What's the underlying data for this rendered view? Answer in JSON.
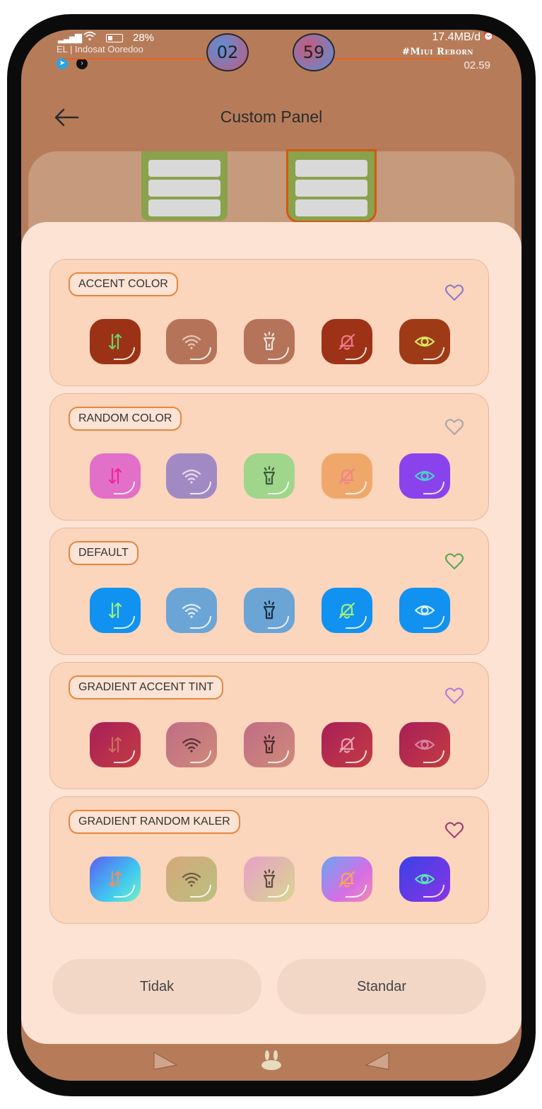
{
  "status_bar": {
    "carrier": "EL | Indosat Ooredoo",
    "battery": "28%",
    "clock_hours": "02",
    "clock_minutes": "59",
    "net_speed": "17.4MB/d",
    "brand": "#Miui Reborn",
    "time": "02.59",
    "icons": [
      "signal-icon",
      "wifi-icon",
      "battery-icon",
      "telegram-icon",
      "terminal-icon",
      "alarm-off-icon"
    ]
  },
  "header": {
    "title": "Custom Panel",
    "back_icon": "arrow-left-icon"
  },
  "groups": [
    {
      "label": "ACCENT COLOR",
      "heart_color": "#8a79c9",
      "tiles": [
        {
          "icon": "data-arrows-icon",
          "bg": "#9b3215",
          "fg": "#6cd36a"
        },
        {
          "icon": "wifi-icon",
          "bg": "#b5735a",
          "fg": "#e6c7b8"
        },
        {
          "icon": "flashlight-icon",
          "bg": "#b5735a",
          "fg": "#efe2da"
        },
        {
          "icon": "bell-off-icon",
          "bg": "#9e3216",
          "fg": "#f1788c"
        },
        {
          "icon": "eye-icon",
          "bg": "#9e3b16",
          "fg": "#d6ea67"
        }
      ]
    },
    {
      "label": "RANDOM COLOR",
      "heart_color": "#a7a7a7",
      "tiles": [
        {
          "icon": "data-arrows-icon",
          "bg": "#e26fc8",
          "fg": "#f3239c"
        },
        {
          "icon": "wifi-icon",
          "bg": "#a18ac4",
          "fg": "#e8dcf2"
        },
        {
          "icon": "flashlight-icon",
          "bg": "#9fd68b",
          "fg": "#3e5a37"
        },
        {
          "icon": "bell-off-icon",
          "bg": "#f0a86a",
          "fg": "#f0848a"
        },
        {
          "icon": "eye-icon",
          "bg": "#8a43ec",
          "fg": "#4bd2c6"
        }
      ]
    },
    {
      "label": "DEFAULT",
      "heart_color": "#55a84d",
      "tiles": [
        {
          "icon": "data-arrows-icon",
          "bg": "#1192f0",
          "fg": "#9ff17b"
        },
        {
          "icon": "wifi-icon",
          "bg": "#6aa5d6",
          "fg": "#e7f0f7"
        },
        {
          "icon": "flashlight-icon",
          "bg": "#6aa5d6",
          "fg": "#1b2d3d"
        },
        {
          "icon": "bell-off-icon",
          "bg": "#1192f0",
          "fg": "#9ff17b"
        },
        {
          "icon": "eye-icon",
          "bg": "#1192f0",
          "fg": "#d9f0ff"
        }
      ]
    },
    {
      "label": "GRADIENT ACCENT TINT",
      "heart_color": "#b17ad9",
      "tiles": [
        {
          "icon": "data-arrows-icon",
          "bg": "#b9235a",
          "fg": "#c9705e",
          "gradient": "linear-gradient(135deg,#a81f5a,#c43c40)"
        },
        {
          "icon": "wifi-icon",
          "bg": "#c67580",
          "fg": "#5a3136",
          "gradient": "linear-gradient(135deg,#c06d86,#cf8a78)"
        },
        {
          "icon": "flashlight-icon",
          "bg": "#c67580",
          "fg": "#4e2a2a",
          "gradient": "linear-gradient(135deg,#c06d86,#cf8a78)"
        },
        {
          "icon": "bell-off-icon",
          "bg": "#b9235a",
          "fg": "#e7a4b4",
          "gradient": "linear-gradient(135deg,#a81f5a,#c43c40)"
        },
        {
          "icon": "eye-icon",
          "bg": "#b9235a",
          "fg": "#d983a2",
          "gradient": "linear-gradient(135deg,#a81f5a,#c43c40)"
        }
      ]
    },
    {
      "label": "GRADIENT RANDOM KALER",
      "heart_color": "#a13a6a",
      "tiles": [
        {
          "icon": "data-arrows-icon",
          "bg": "#4e7ff0",
          "fg": "#ff8a58",
          "gradient": "linear-gradient(135deg,#5b5ff2,#40c8f0 60%,#74f0c4)"
        },
        {
          "icon": "wifi-icon",
          "bg": "#c9ae7c",
          "fg": "#6a5a40",
          "gradient": "linear-gradient(135deg,#d5a87a,#b9c07f)"
        },
        {
          "icon": "flashlight-icon",
          "bg": "#e7aec0",
          "fg": "#5b4a3f",
          "gradient": "linear-gradient(135deg,#e8a0c8,#d8d68f)"
        },
        {
          "icon": "bell-off-icon",
          "bg": "#b07ce8",
          "fg": "#ffa25a",
          "gradient": "linear-gradient(135deg,#6aa7f2,#d56ee6 60%,#f28ab0)"
        },
        {
          "icon": "eye-icon",
          "bg": "#4c34e0",
          "fg": "#58e6b2",
          "gradient": "linear-gradient(135deg,#3a42e6,#8a34e6)"
        }
      ]
    }
  ],
  "buttons": {
    "no": "Tidak",
    "standard": "Standar"
  },
  "nav": {
    "icons": [
      "back-triangle-icon",
      "home-rabbit-icon",
      "recents-triangle-icon"
    ]
  },
  "colors": {
    "screen_bg": "#b67c5a",
    "sheet_bg": "#fde3d4",
    "card_bg": "#fbd5bc",
    "label_border": "#e5873f"
  }
}
